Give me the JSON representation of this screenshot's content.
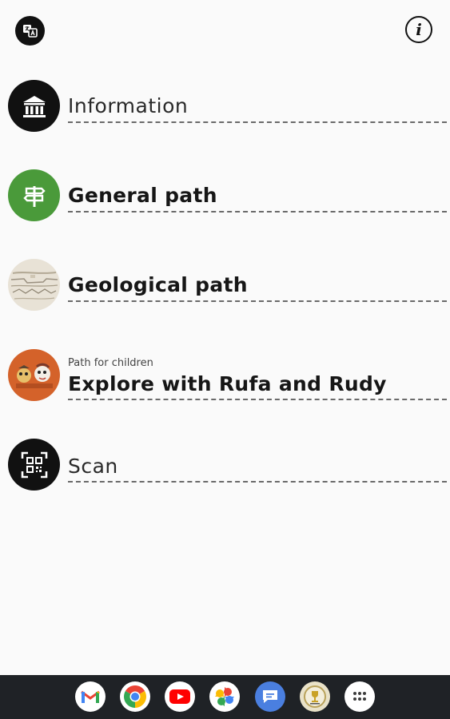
{
  "header": {
    "translate_icon": "translate-icon",
    "info_icon": "info-icon",
    "info_glyph": "i"
  },
  "menu": [
    {
      "label": "Information",
      "icon": "museum-icon",
      "icon_bg": "#111111"
    },
    {
      "label": "General path",
      "icon": "signpost-icon",
      "icon_bg": "#4a9a3a"
    },
    {
      "label": "Geological path",
      "icon": "geological-layers-icon",
      "icon_bg": "#e8e2d6"
    },
    {
      "sublabel": "Path for children",
      "label": "Explore with Rufa and Rudy",
      "icon": "children-characters-icon",
      "icon_bg": "#d4622a"
    },
    {
      "label": "Scan",
      "icon": "qr-scan-icon",
      "icon_bg": "#111111"
    }
  ],
  "taskbar": {
    "apps": [
      "gmail-icon",
      "chrome-icon",
      "youtube-icon",
      "photos-icon",
      "messages-icon",
      "app-badge-icon",
      "app-drawer-icon"
    ]
  },
  "colors": {
    "background": "#fafafa",
    "text": "#161616",
    "taskbar": "#1f2226"
  }
}
